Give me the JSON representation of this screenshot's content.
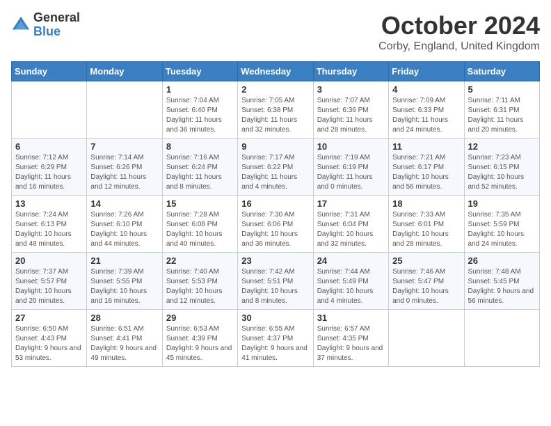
{
  "header": {
    "logo_general": "General",
    "logo_blue": "Blue",
    "month_title": "October 2024",
    "subtitle": "Corby, England, United Kingdom"
  },
  "weekdays": [
    "Sunday",
    "Monday",
    "Tuesday",
    "Wednesday",
    "Thursday",
    "Friday",
    "Saturday"
  ],
  "weeks": [
    [
      {
        "day": "",
        "info": ""
      },
      {
        "day": "",
        "info": ""
      },
      {
        "day": "1",
        "info": "Sunrise: 7:04 AM\nSunset: 6:40 PM\nDaylight: 11 hours and 36 minutes."
      },
      {
        "day": "2",
        "info": "Sunrise: 7:05 AM\nSunset: 6:38 PM\nDaylight: 11 hours and 32 minutes."
      },
      {
        "day": "3",
        "info": "Sunrise: 7:07 AM\nSunset: 6:36 PM\nDaylight: 11 hours and 28 minutes."
      },
      {
        "day": "4",
        "info": "Sunrise: 7:09 AM\nSunset: 6:33 PM\nDaylight: 11 hours and 24 minutes."
      },
      {
        "day": "5",
        "info": "Sunrise: 7:11 AM\nSunset: 6:31 PM\nDaylight: 11 hours and 20 minutes."
      }
    ],
    [
      {
        "day": "6",
        "info": "Sunrise: 7:12 AM\nSunset: 6:29 PM\nDaylight: 11 hours and 16 minutes."
      },
      {
        "day": "7",
        "info": "Sunrise: 7:14 AM\nSunset: 6:26 PM\nDaylight: 11 hours and 12 minutes."
      },
      {
        "day": "8",
        "info": "Sunrise: 7:16 AM\nSunset: 6:24 PM\nDaylight: 11 hours and 8 minutes."
      },
      {
        "day": "9",
        "info": "Sunrise: 7:17 AM\nSunset: 6:22 PM\nDaylight: 11 hours and 4 minutes."
      },
      {
        "day": "10",
        "info": "Sunrise: 7:19 AM\nSunset: 6:19 PM\nDaylight: 11 hours and 0 minutes."
      },
      {
        "day": "11",
        "info": "Sunrise: 7:21 AM\nSunset: 6:17 PM\nDaylight: 10 hours and 56 minutes."
      },
      {
        "day": "12",
        "info": "Sunrise: 7:23 AM\nSunset: 6:15 PM\nDaylight: 10 hours and 52 minutes."
      }
    ],
    [
      {
        "day": "13",
        "info": "Sunrise: 7:24 AM\nSunset: 6:13 PM\nDaylight: 10 hours and 48 minutes."
      },
      {
        "day": "14",
        "info": "Sunrise: 7:26 AM\nSunset: 6:10 PM\nDaylight: 10 hours and 44 minutes."
      },
      {
        "day": "15",
        "info": "Sunrise: 7:28 AM\nSunset: 6:08 PM\nDaylight: 10 hours and 40 minutes."
      },
      {
        "day": "16",
        "info": "Sunrise: 7:30 AM\nSunset: 6:06 PM\nDaylight: 10 hours and 36 minutes."
      },
      {
        "day": "17",
        "info": "Sunrise: 7:31 AM\nSunset: 6:04 PM\nDaylight: 10 hours and 32 minutes."
      },
      {
        "day": "18",
        "info": "Sunrise: 7:33 AM\nSunset: 6:01 PM\nDaylight: 10 hours and 28 minutes."
      },
      {
        "day": "19",
        "info": "Sunrise: 7:35 AM\nSunset: 5:59 PM\nDaylight: 10 hours and 24 minutes."
      }
    ],
    [
      {
        "day": "20",
        "info": "Sunrise: 7:37 AM\nSunset: 5:57 PM\nDaylight: 10 hours and 20 minutes."
      },
      {
        "day": "21",
        "info": "Sunrise: 7:39 AM\nSunset: 5:55 PM\nDaylight: 10 hours and 16 minutes."
      },
      {
        "day": "22",
        "info": "Sunrise: 7:40 AM\nSunset: 5:53 PM\nDaylight: 10 hours and 12 minutes."
      },
      {
        "day": "23",
        "info": "Sunrise: 7:42 AM\nSunset: 5:51 PM\nDaylight: 10 hours and 8 minutes."
      },
      {
        "day": "24",
        "info": "Sunrise: 7:44 AM\nSunset: 5:49 PM\nDaylight: 10 hours and 4 minutes."
      },
      {
        "day": "25",
        "info": "Sunrise: 7:46 AM\nSunset: 5:47 PM\nDaylight: 10 hours and 0 minutes."
      },
      {
        "day": "26",
        "info": "Sunrise: 7:48 AM\nSunset: 5:45 PM\nDaylight: 9 hours and 56 minutes."
      }
    ],
    [
      {
        "day": "27",
        "info": "Sunrise: 6:50 AM\nSunset: 4:43 PM\nDaylight: 9 hours and 53 minutes."
      },
      {
        "day": "28",
        "info": "Sunrise: 6:51 AM\nSunset: 4:41 PM\nDaylight: 9 hours and 49 minutes."
      },
      {
        "day": "29",
        "info": "Sunrise: 6:53 AM\nSunset: 4:39 PM\nDaylight: 9 hours and 45 minutes."
      },
      {
        "day": "30",
        "info": "Sunrise: 6:55 AM\nSunset: 4:37 PM\nDaylight: 9 hours and 41 minutes."
      },
      {
        "day": "31",
        "info": "Sunrise: 6:57 AM\nSunset: 4:35 PM\nDaylight: 9 hours and 37 minutes."
      },
      {
        "day": "",
        "info": ""
      },
      {
        "day": "",
        "info": ""
      }
    ]
  ]
}
